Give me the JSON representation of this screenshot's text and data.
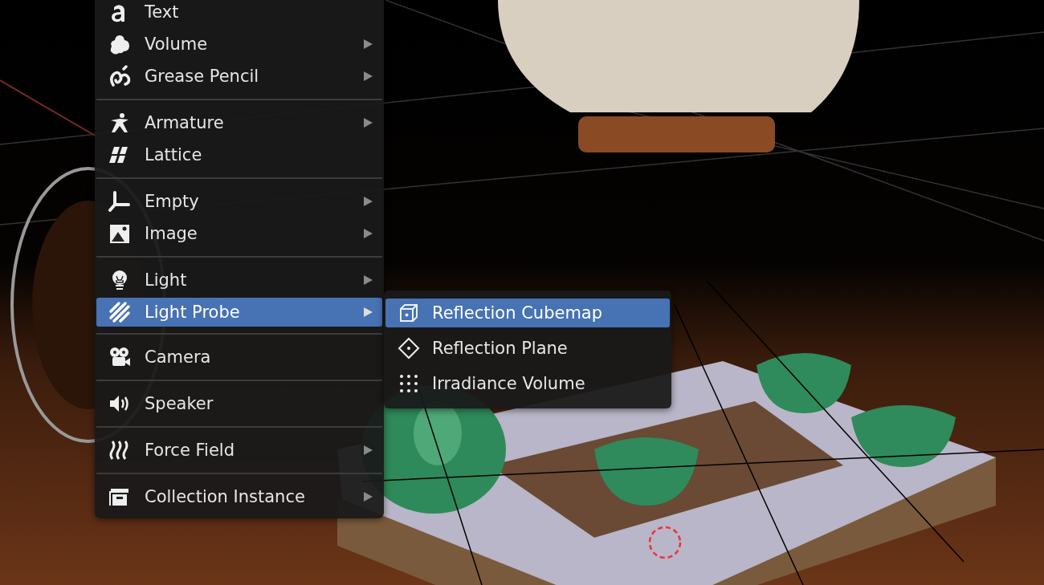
{
  "add_menu": {
    "sections": [
      [
        {
          "label": "Text",
          "has_submenu": false,
          "selected": false
        },
        {
          "label": "Volume",
          "has_submenu": true,
          "selected": false
        },
        {
          "label": "Grease Pencil",
          "has_submenu": true,
          "selected": false
        }
      ],
      [
        {
          "label": "Armature",
          "has_submenu": true,
          "selected": false
        },
        {
          "label": "Lattice",
          "has_submenu": false,
          "selected": false
        }
      ],
      [
        {
          "label": "Empty",
          "has_submenu": true,
          "selected": false
        },
        {
          "label": "Image",
          "has_submenu": true,
          "selected": false
        }
      ],
      [
        {
          "label": "Light",
          "has_submenu": true,
          "selected": false
        },
        {
          "label": "Light Probe",
          "has_submenu": true,
          "selected": true
        }
      ],
      [
        {
          "label": "Camera",
          "has_submenu": false,
          "selected": false
        }
      ],
      [
        {
          "label": "Speaker",
          "has_submenu": false,
          "selected": false
        }
      ],
      [
        {
          "label": "Force Field",
          "has_submenu": true,
          "selected": false
        }
      ],
      [
        {
          "label": "Collection Instance",
          "has_submenu": true,
          "selected": false
        }
      ]
    ]
  },
  "light_probe_submenu": {
    "items": [
      {
        "label": "Reflection Cubemap",
        "selected": true
      },
      {
        "label": "Reflection Plane",
        "selected": false
      },
      {
        "label": "Irradiance Volume",
        "selected": false
      }
    ]
  }
}
